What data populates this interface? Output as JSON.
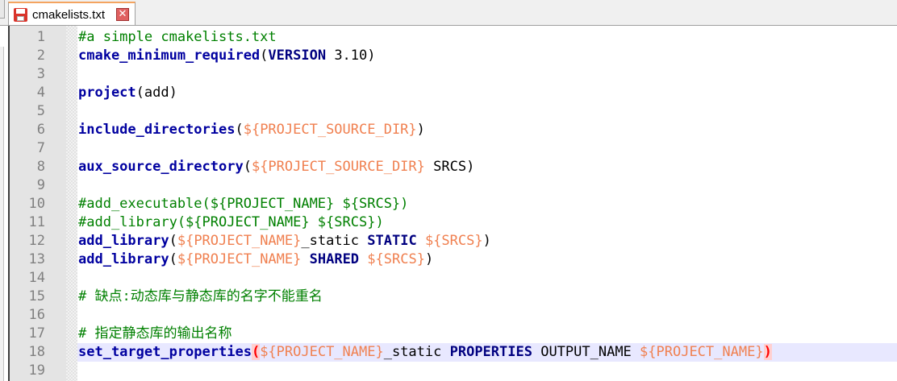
{
  "tab": {
    "title": "cmakelists.txt"
  },
  "colors": {
    "keyword": "#0000a0",
    "variable": "#f08050",
    "comment": "#008000",
    "current_line": "#e8e8ff"
  },
  "lines": [
    {
      "n": "1",
      "c": "#a simple cmakelists.txt"
    },
    {
      "n": "2",
      "kw": "cmake_minimum_required",
      "p1": "(",
      "param": "VERSION",
      "rest": " 3.10)"
    },
    {
      "n": "3"
    },
    {
      "n": "4",
      "kw": "project",
      "rest": "(add)"
    },
    {
      "n": "5"
    },
    {
      "n": "6",
      "kw": "include_directories",
      "p1": "(",
      "v1": "${PROJECT_SOURCE_DIR}",
      "rest": ")"
    },
    {
      "n": "7"
    },
    {
      "n": "8",
      "kw": "aux_source_directory",
      "p1": "(",
      "v1": "${PROJECT_SOURCE_DIR}",
      "rest": " SRCS)"
    },
    {
      "n": "9"
    },
    {
      "n": "10",
      "c": "#add_executable(${PROJECT_NAME} ${SRCS})"
    },
    {
      "n": "11",
      "c": "#add_library(${PROJECT_NAME} ${SRCS})"
    },
    {
      "n": "12",
      "kw": "add_library",
      "p1": "(",
      "v1": "${PROJECT_NAME}",
      "mid": "_static ",
      "param": "STATIC",
      "sp": " ",
      "v2": "${SRCS}",
      "rest": ")"
    },
    {
      "n": "13",
      "kw": "add_library",
      "p1": "(",
      "v1": "${PROJECT_NAME}",
      "mid": " ",
      "param": "SHARED",
      "sp": " ",
      "v2": "${SRCS}",
      "rest": ")"
    },
    {
      "n": "14"
    },
    {
      "n": "15",
      "c": "# 缺点:动态库与静态库的名字不能重名"
    },
    {
      "n": "16"
    },
    {
      "n": "17",
      "c": "# 指定静态库的输出名称"
    },
    {
      "n": "18",
      "kw": "set_target_properties",
      "p1": "(",
      "v1": "${PROJECT_NAME}",
      "mid": "_static ",
      "param": "PROPERTIES",
      "sp": " OUTPUT_NAME ",
      "v2": "${PROJECT_NAME}",
      "rest": ")"
    },
    {
      "n": "19"
    }
  ]
}
